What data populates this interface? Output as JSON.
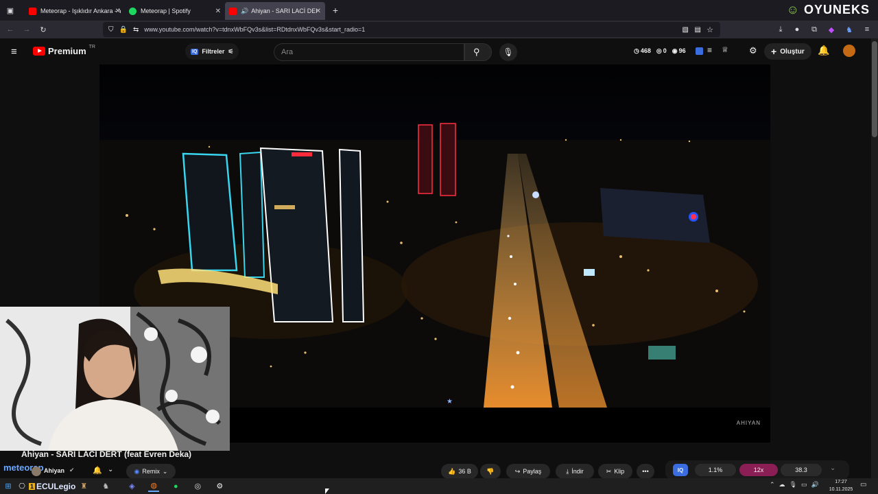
{
  "browser": {
    "tabs": [
      {
        "title": "Meteorap - Işıklıdır Ankara - Yo",
        "favicon_color": "#ff0000",
        "active": false
      },
      {
        "title": "Meteorap | Spotify",
        "favicon_color": "#1ed760",
        "active": false
      },
      {
        "title": "Ahiyan - SARI LACİ DERT (f",
        "favicon_color": "#ff0000",
        "active": true
      }
    ],
    "url": "www.youtube.com/watch?v=tdnxWbFQv3s&list=RDtdnxWbFQv3s&start_radio=1",
    "watermark": "OYUNEKS"
  },
  "youtube": {
    "brand": "Premium",
    "region": "TR",
    "filter_label": "Filtreler",
    "search_placeholder": "Ara",
    "stats": {
      "views": "468",
      "likes": "0",
      "dislikes": "96"
    },
    "create_label": "Oluştur",
    "video_watermark": "AHIYAN"
  },
  "video": {
    "title": "Ahiyan - SARI LACİ DERT (feat Evren Deka)",
    "channel": "Ahiyan",
    "overlay_name": "meteorap",
    "remix_label": "Remix",
    "like_count": "36 B",
    "share_label": "Paylaş",
    "download_label": "İndir",
    "clip_label": "Klip",
    "controls": {
      "iq": "IQ",
      "pct": "1.1%",
      "speed": "12x",
      "value": "38.3"
    }
  },
  "taskbar": {
    "label": "ECULegio",
    "time": "17:27",
    "date": "10.11.2025"
  }
}
